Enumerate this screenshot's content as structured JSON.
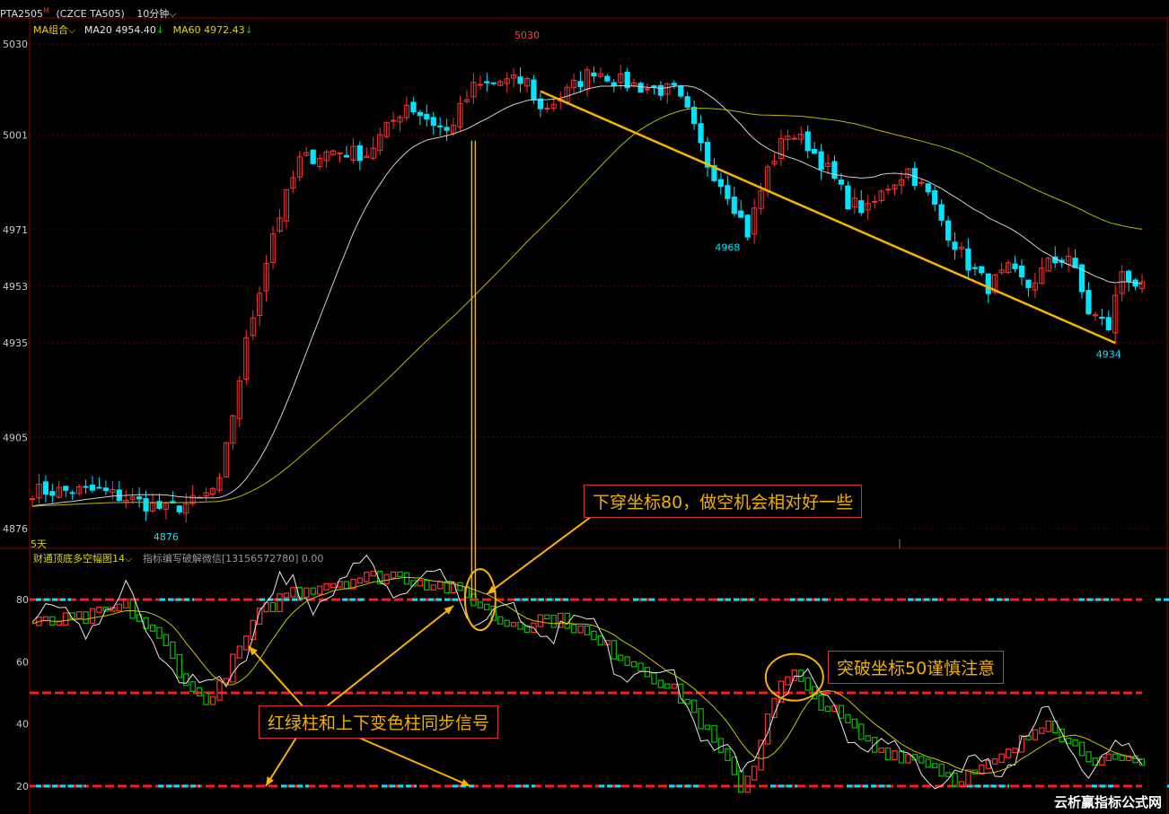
{
  "header": {
    "symbol": "PTA2505",
    "symbol_mark": "M",
    "exchange": "(CZCE TA505)",
    "period": "10分钟",
    "period_arrow": "⌵",
    "ma_group": "MA组合⌵",
    "ma20_label": "MA20 4954.40",
    "ma20_arrow": "↓",
    "ma60_label": "MA60 4972.43",
    "ma60_arrow": "↓"
  },
  "indicator_header": {
    "name": "财通顶底多空幅图14⌵",
    "note": "指标编写破解微信[13156572780] 0.00"
  },
  "price_axis": {
    "ticks": [
      "5030",
      "5001",
      "4971",
      "4953",
      "4935",
      "4905",
      "4876"
    ],
    "bottom_note": "5天"
  },
  "indicator_axis": {
    "ticks": [
      "80",
      "60",
      "40",
      "20"
    ]
  },
  "price_labels": {
    "high": "5030",
    "low1": "4876",
    "low2": "4968",
    "low3": "4934"
  },
  "annotations": {
    "cross80": "下穿坐标80，做空机会相对好一些",
    "break50": "突破坐标50谨慎注意",
    "sync": "红绿柱和上下变色柱同步信号"
  },
  "watermark": "云析赢指标公式网",
  "colors": {
    "bull": "#ff3030",
    "bear": "#00e5ff",
    "ma20": "#cfcfcf",
    "ma60": "#b8b800",
    "arrow": "#f8b400",
    "ind_red": "#ff3030",
    "ind_green": "#00c000",
    "level80": "#ff1a1a",
    "level80_alt": "#00e5ff",
    "grid": "#5a0000"
  },
  "chart_data": [
    {
      "type": "candlestick",
      "title": "PTA2505 10分钟",
      "ylim": [
        4870,
        5036
      ],
      "y_ticks": [
        5030,
        5001,
        4971,
        4953,
        4935,
        4905,
        4876
      ],
      "series": [
        {
          "name": "MA20",
          "last": 4954.4
        },
        {
          "name": "MA60",
          "last": 4972.43
        }
      ],
      "marked_points": [
        {
          "label": "5030",
          "value": 5030
        },
        {
          "label": "4876",
          "value": 4876
        },
        {
          "label": "4968",
          "value": 4968
        },
        {
          "label": "4934",
          "value": 4934
        }
      ],
      "trend_line": {
        "from": 5015,
        "to": 4935
      },
      "anchors": [
        [
          0,
          4888
        ],
        [
          10,
          4888
        ],
        [
          20,
          4882
        ],
        [
          25,
          4885
        ],
        [
          28,
          4890
        ],
        [
          32,
          4935
        ],
        [
          36,
          4970
        ],
        [
          40,
          4993
        ],
        [
          45,
          4996
        ],
        [
          50,
          4995
        ],
        [
          56,
          5011
        ],
        [
          62,
          5002
        ],
        [
          66,
          5016
        ],
        [
          70,
          5018
        ],
        [
          74,
          5018
        ],
        [
          76,
          5009
        ],
        [
          79,
          5013
        ],
        [
          84,
          5022
        ],
        [
          88,
          5018
        ],
        [
          92,
          5016
        ],
        [
          96,
          5015
        ],
        [
          98,
          5008
        ],
        [
          101,
          4992
        ],
        [
          104,
          4983
        ],
        [
          107,
          4970
        ],
        [
          110,
          4990
        ],
        [
          113,
          5002
        ],
        [
          116,
          4998
        ],
        [
          119,
          4990
        ],
        [
          122,
          4980
        ],
        [
          125,
          4977
        ],
        [
          128,
          4985
        ],
        [
          131,
          4990
        ],
        [
          134,
          4982
        ],
        [
          137,
          4970
        ],
        [
          140,
          4960
        ],
        [
          143,
          4953
        ],
        [
          146,
          4958
        ],
        [
          149,
          4953
        ],
        [
          152,
          4960
        ],
        [
          155,
          4963
        ],
        [
          158,
          4945
        ],
        [
          161,
          4940
        ],
        [
          163,
          4958
        ],
        [
          166,
          4952
        ]
      ]
    },
    {
      "type": "line",
      "title": "财通顶底多空幅图14",
      "ylim": [
        11,
        91
      ],
      "y_ticks": [
        80,
        60,
        40,
        20
      ],
      "levels": [
        80,
        50,
        20
      ],
      "anchors": [
        [
          0,
          72
        ],
        [
          8,
          74
        ],
        [
          14,
          78
        ],
        [
          20,
          65
        ],
        [
          24,
          50
        ],
        [
          27,
          48
        ],
        [
          30,
          60
        ],
        [
          34,
          75
        ],
        [
          38,
          82
        ],
        [
          44,
          85
        ],
        [
          50,
          87
        ],
        [
          54,
          88
        ],
        [
          58,
          86
        ],
        [
          62,
          84
        ],
        [
          66,
          80
        ],
        [
          70,
          73
        ],
        [
          74,
          72
        ],
        [
          76,
          74
        ],
        [
          80,
          73
        ],
        [
          84,
          67
        ],
        [
          88,
          62
        ],
        [
          92,
          57
        ],
        [
          98,
          47
        ],
        [
          102,
          34
        ],
        [
          106,
          20
        ],
        [
          108,
          26
        ],
        [
          110,
          44
        ],
        [
          112,
          52
        ],
        [
          114,
          56
        ],
        [
          116,
          50
        ],
        [
          118,
          47
        ],
        [
          122,
          40
        ],
        [
          126,
          32
        ],
        [
          130,
          30
        ],
        [
          134,
          28
        ],
        [
          138,
          22
        ],
        [
          142,
          25
        ],
        [
          146,
          30
        ],
        [
          150,
          38
        ],
        [
          152,
          42
        ],
        [
          155,
          34
        ],
        [
          160,
          28
        ],
        [
          166,
          27
        ]
      ]
    }
  ]
}
